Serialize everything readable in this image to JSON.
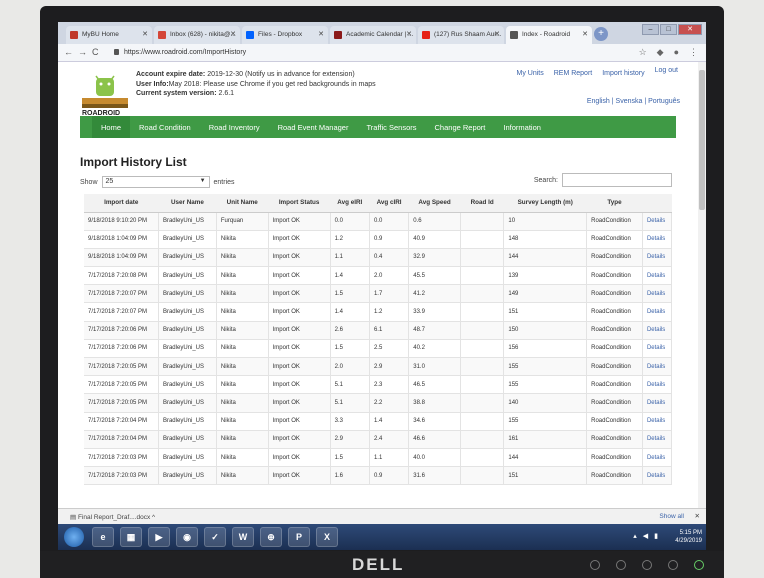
{
  "browser": {
    "tabs": [
      {
        "label": "MyBU Home",
        "color": "#c0392b"
      },
      {
        "label": "Inbox (628) - nikita@...",
        "color": "#d44638"
      },
      {
        "label": "Files - Dropbox",
        "color": "#0061fe"
      },
      {
        "label": "Academic Calendar | ...",
        "color": "#8b1a1a"
      },
      {
        "label": "(127) Rus Shaam Aur...",
        "color": "#e62117"
      },
      {
        "label": "Index - Roadroid",
        "color": "#555555"
      }
    ],
    "url": "https://www.roadroid.com/ImportHistory"
  },
  "site": {
    "logo_text": "ROADROID",
    "account_expire_label": "Account expire date:",
    "account_expire_value": "2019-12-30 (Notify us in advance for extension)",
    "user_info_label": "User Info:",
    "user_info_value": "May 2018: Please use Chrome if you get red backgrounds in maps",
    "version_label": "Current system version:",
    "version_value": "2.6.1",
    "top_links": [
      "My Units",
      "REM Report",
      "Import history",
      "Log out"
    ],
    "languages": "English | Svenska | Português",
    "nav": [
      "Home",
      "Road Condition",
      "Road Inventory",
      "Road Event Manager",
      "Traffic Sensors",
      "Change Report",
      "Information"
    ]
  },
  "main": {
    "title": "Import History List",
    "show_label": "Show",
    "show_value": "25",
    "entries_label": "entries",
    "search_label": "Search:",
    "columns": [
      "Import date",
      "User Name",
      "Unit Name",
      "Import Status",
      "Avg eIRI",
      "Avg cIRI",
      "Avg Speed",
      "Road Id",
      "Survey Length (m)",
      "Type",
      ""
    ],
    "rows": [
      [
        "9/18/2018 9:10:20 PM",
        "BradleyUni_US",
        "Furquan",
        "Import OK",
        "0.0",
        "0.0",
        "0.6",
        "",
        "10",
        "RoadCondition",
        "Details"
      ],
      [
        "9/18/2018 1:04:09 PM",
        "BradleyUni_US",
        "Nikita",
        "Import OK",
        "1.2",
        "0.9",
        "40.9",
        "",
        "148",
        "RoadCondition",
        "Details"
      ],
      [
        "9/18/2018 1:04:09 PM",
        "BradleyUni_US",
        "Nikita",
        "Import OK",
        "1.1",
        "0.4",
        "32.9",
        "",
        "144",
        "RoadCondition",
        "Details"
      ],
      [
        "7/17/2018 7:20:08 PM",
        "BradleyUni_US",
        "Nikita",
        "Import OK",
        "1.4",
        "2.0",
        "45.5",
        "",
        "139",
        "RoadCondition",
        "Details"
      ],
      [
        "7/17/2018 7:20:07 PM",
        "BradleyUni_US",
        "Nikita",
        "Import OK",
        "1.5",
        "1.7",
        "41.2",
        "",
        "149",
        "RoadCondition",
        "Details"
      ],
      [
        "7/17/2018 7:20:07 PM",
        "BradleyUni_US",
        "Nikita",
        "Import OK",
        "1.4",
        "1.2",
        "33.9",
        "",
        "151",
        "RoadCondition",
        "Details"
      ],
      [
        "7/17/2018 7:20:06 PM",
        "BradleyUni_US",
        "Nikita",
        "Import OK",
        "2.6",
        "6.1",
        "48.7",
        "",
        "150",
        "RoadCondition",
        "Details"
      ],
      [
        "7/17/2018 7:20:06 PM",
        "BradleyUni_US",
        "Nikita",
        "Import OK",
        "1.5",
        "2.5",
        "40.2",
        "",
        "156",
        "RoadCondition",
        "Details"
      ],
      [
        "7/17/2018 7:20:05 PM",
        "BradleyUni_US",
        "Nikita",
        "Import OK",
        "2.0",
        "2.9",
        "31.0",
        "",
        "155",
        "RoadCondition",
        "Details"
      ],
      [
        "7/17/2018 7:20:05 PM",
        "BradleyUni_US",
        "Nikita",
        "Import OK",
        "5.1",
        "2.3",
        "46.5",
        "",
        "155",
        "RoadCondition",
        "Details"
      ],
      [
        "7/17/2018 7:20:05 PM",
        "BradleyUni_US",
        "Nikita",
        "Import OK",
        "5.1",
        "2.2",
        "38.8",
        "",
        "140",
        "RoadCondition",
        "Details"
      ],
      [
        "7/17/2018 7:20:04 PM",
        "BradleyUni_US",
        "Nikita",
        "Import OK",
        "3.3",
        "1.4",
        "34.6",
        "",
        "155",
        "RoadCondition",
        "Details"
      ],
      [
        "7/17/2018 7:20:04 PM",
        "BradleyUni_US",
        "Nikita",
        "Import OK",
        "2.9",
        "2.4",
        "46.6",
        "",
        "161",
        "RoadCondition",
        "Details"
      ],
      [
        "7/17/2018 7:20:03 PM",
        "BradleyUni_US",
        "Nikita",
        "Import OK",
        "1.5",
        "1.1",
        "40.0",
        "",
        "144",
        "RoadCondition",
        "Details"
      ],
      [
        "7/17/2018 7:20:03 PM",
        "BradleyUni_US",
        "Nikita",
        "Import OK",
        "1.6",
        "0.9",
        "31.6",
        "",
        "151",
        "RoadCondition",
        "Details"
      ]
    ]
  },
  "downloads": {
    "item": "Final Report_Draf....docx",
    "show_all": "Show all"
  },
  "taskbar": {
    "time": "5:15 PM",
    "date": "4/29/2019"
  },
  "monitor": {
    "brand": "DELL"
  }
}
